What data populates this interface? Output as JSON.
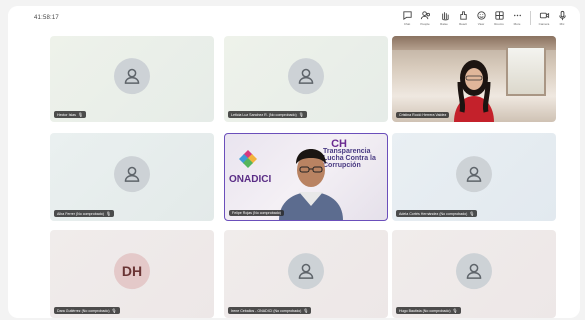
{
  "meeting": {
    "timer": "41:58:17"
  },
  "toolbar": {
    "buttons": [
      {
        "label": "Chat",
        "icon": "chat-icon"
      },
      {
        "label": "People",
        "icon": "people-icon"
      },
      {
        "label": "Raise",
        "icon": "raise-hand-icon"
      },
      {
        "label": "React",
        "icon": "react-icon"
      },
      {
        "label": "View",
        "icon": "view-icon"
      },
      {
        "label": "Rooms",
        "icon": "rooms-icon"
      },
      {
        "label": "More",
        "icon": "more-icon"
      },
      {
        "label": "Camera",
        "icon": "camera-icon"
      },
      {
        "label": "Mic",
        "icon": "mic-icon"
      }
    ]
  },
  "participants": [
    {
      "name": "Hector Islas"
    },
    {
      "name": "Leticia Luz Sanchez R. (No comprobado)"
    },
    {
      "name": "Cristina Roció Herrera Valdez"
    },
    {
      "name": "Alba Ferrer (No comprobado)"
    },
    {
      "name": "Felipe Rojas (No comprobado)"
    },
    {
      "name": "Adela Cortés Hernández (No comprobado)"
    },
    {
      "name": "Dara Gutiérrez (No comprobado)",
      "initials": "DH"
    },
    {
      "name": "Irene Ceballos - ONADICI (No comprobado)"
    },
    {
      "name": "Hugo Bautista (No comprobado)"
    }
  ],
  "speaker_banner": {
    "logo_text": "ONADICI",
    "headline": "CH",
    "subtitle": "Transparencia Lucha Contra la Corrupción"
  }
}
